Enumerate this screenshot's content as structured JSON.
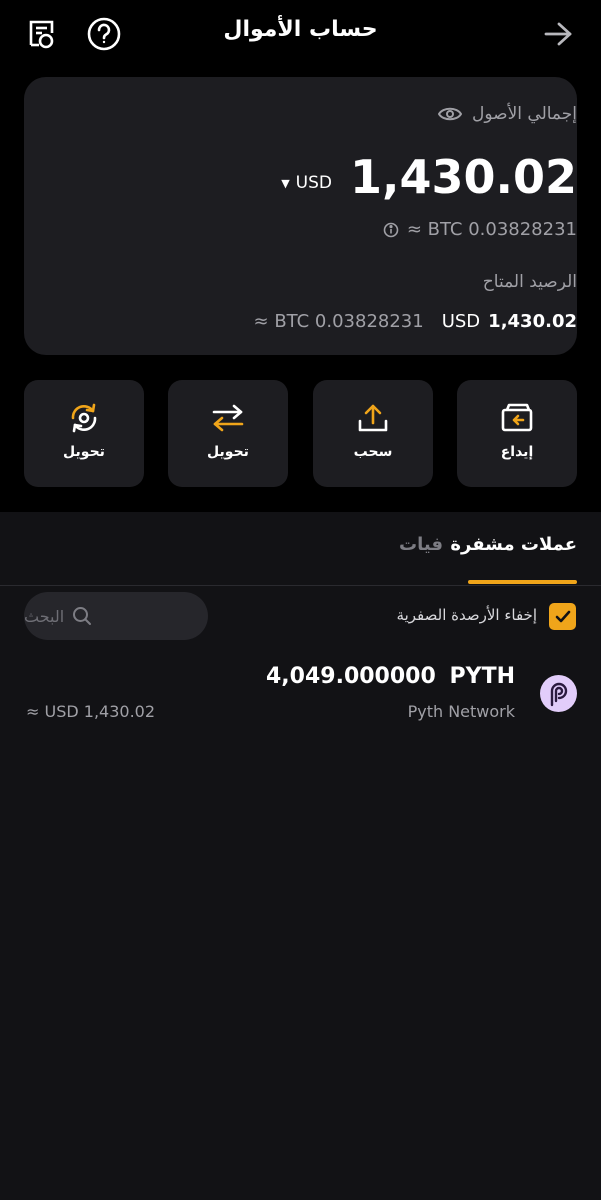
{
  "header": {
    "title": "حساب الأموال"
  },
  "balance_card": {
    "total_label": "إجمالي الأصول",
    "amount": "1,430.02",
    "currency": "USD",
    "btc_approx": "BTC 0.03828231 ≈",
    "available_label": "الرصيد المتاح",
    "available_usd_currency": "USD",
    "available_usd_amount": "1,430.02",
    "available_btc": "BTC 0.03828231 ≈"
  },
  "actions": [
    {
      "label": "إيداع",
      "icon": "deposit-icon"
    },
    {
      "label": "سحب",
      "icon": "withdraw-icon"
    },
    {
      "label": "تحويل",
      "icon": "transfer-icon"
    },
    {
      "label": "تحويل",
      "icon": "convert-icon"
    }
  ],
  "tabs": [
    {
      "label": "عملات مشفرة",
      "active": true
    },
    {
      "label": "فيات",
      "active": false
    }
  ],
  "filter": {
    "hide_zero_label": "إخفاء الأرصدة الصفرية",
    "hide_zero_checked": true
  },
  "search": {
    "placeholder": "البحث"
  },
  "assets": [
    {
      "symbol": "PYTH",
      "name": "Pyth Network",
      "amount": "4,049.000000",
      "usd_value": "USD 1,430.02 ≈"
    }
  ],
  "colors": {
    "accent": "#f0a51a",
    "background": "#121215",
    "card": "#1d1d21",
    "header_bg": "#000000"
  }
}
